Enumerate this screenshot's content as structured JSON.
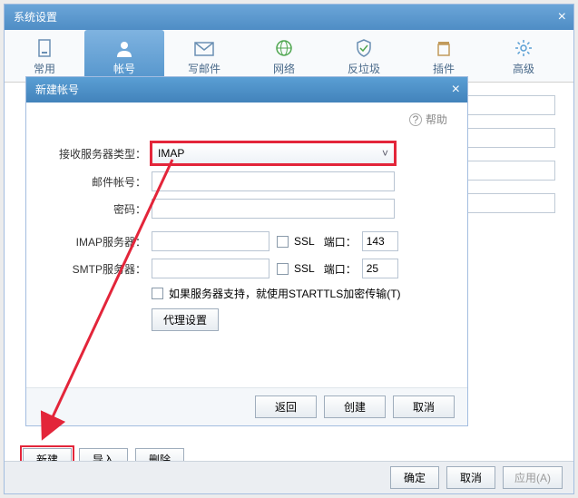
{
  "main_window": {
    "title": "系统设置",
    "tabs": [
      {
        "label": "常用"
      },
      {
        "label": "帐号"
      },
      {
        "label": "写邮件"
      },
      {
        "label": "网络"
      },
      {
        "label": "反垃圾"
      },
      {
        "label": "插件"
      },
      {
        "label": "高级"
      }
    ],
    "bottom_buttons": {
      "new": "新建",
      "import": "导入",
      "delete": "删除"
    },
    "footer": {
      "ok": "确定",
      "cancel": "取消",
      "apply": "应用(A)"
    }
  },
  "dialog": {
    "title": "新建帐号",
    "help": "帮助",
    "labels": {
      "recv_type": "接收服务器类型：",
      "mail_acc": "邮件帐号：",
      "password": "密码：",
      "imap_srv": "IMAP服务器：",
      "smtp_srv": "SMTP服务器：",
      "ssl": "SSL",
      "port": "端口：",
      "starttls": "如果服务器支持，就使用STARTTLS加密传输(T)",
      "proxy": "代理设置"
    },
    "values": {
      "recv_type": "IMAP",
      "mail_acc": "",
      "password": "",
      "imap_srv": "",
      "smtp_srv": "",
      "imap_port": "143",
      "smtp_port": "25"
    },
    "footer": {
      "back": "返回",
      "create": "创建",
      "cancel": "取消"
    }
  }
}
